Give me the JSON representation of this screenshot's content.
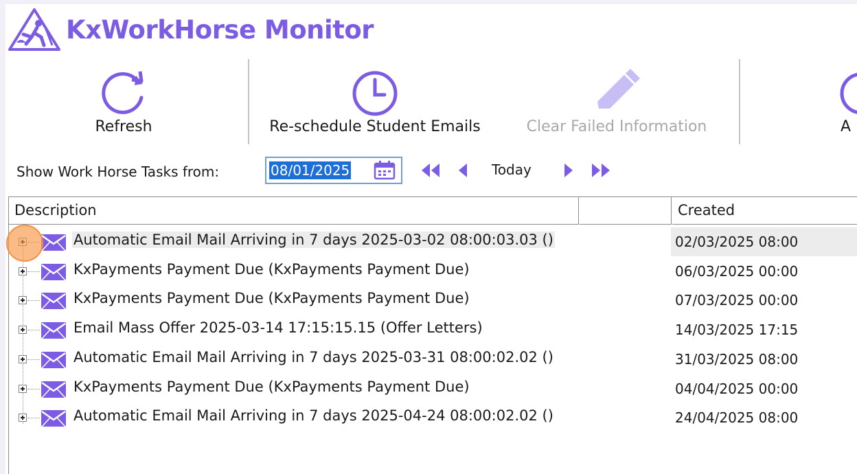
{
  "app": {
    "title": "KxWorkHorse Monitor",
    "logo_icon": "worker-warning-icon",
    "accent_color": "#7b5ce3"
  },
  "toolbar": {
    "refresh_label": "Refresh",
    "reschedule_label": "Re-schedule Student Emails",
    "clear_failed_label": "Clear Failed Information",
    "clear_failed_enabled": false,
    "partial_label": "A"
  },
  "date_filter": {
    "label": "Show Work Horse Tasks from:",
    "value": "08/01/2025",
    "today_label": "Today"
  },
  "grid": {
    "columns": [
      "Description",
      "",
      "Created"
    ],
    "rows": [
      {
        "description": "Automatic Email Mail Arriving in 7 days 2025-03-02 08:00:03.03 ()",
        "created": "02/03/2025 08:00",
        "selected": true
      },
      {
        "description": "KxPayments Payment Due (KxPayments Payment Due)",
        "created": "06/03/2025 00:00"
      },
      {
        "description": "KxPayments Payment Due (KxPayments Payment Due)",
        "created": "07/03/2025 00:00"
      },
      {
        "description": "Email Mass Offer 2025-03-14 17:15:15.15 (Offer Letters)",
        "created": "14/03/2025 17:15"
      },
      {
        "description": "Automatic Email Mail Arriving in 7 days 2025-03-31 08:00:02.02 ()",
        "created": "31/03/2025 08:00"
      },
      {
        "description": "KxPayments Payment Due (KxPayments Payment Due)",
        "created": "04/04/2025 00:00"
      },
      {
        "description": "Automatic Email Mail Arriving in 7 days 2025-04-24 08:00:02.02 ()",
        "created": "24/04/2025 08:00"
      }
    ]
  }
}
